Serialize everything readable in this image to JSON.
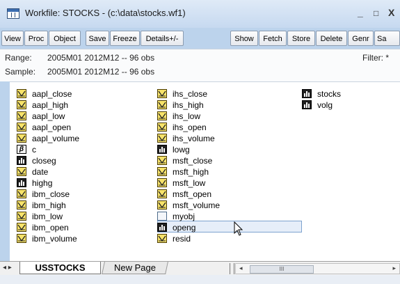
{
  "window": {
    "title": "Workfile: STOCKS - (c:\\data\\stocks.wf1)",
    "minimize_glyph": "_",
    "maximize_glyph": "□",
    "close_glyph": "X"
  },
  "toolbar": {
    "buttons": [
      "View",
      "Proc",
      "Object",
      "Save",
      "Freeze",
      "Details+/-",
      "Show",
      "Fetch",
      "Store",
      "Delete",
      "Genr",
      "Sa"
    ]
  },
  "info": {
    "range_label": "Range:",
    "range_value": "2005M01 2012M12  --  96 obs",
    "sample_label": "Sample:",
    "sample_value": "2005M01 2012M12  --  96 obs",
    "filter": "Filter: *"
  },
  "objects": {
    "col1": [
      {
        "name": "aapl_close",
        "icon": "series-icon"
      },
      {
        "name": "aapl_high",
        "icon": "series-icon"
      },
      {
        "name": "aapl_low",
        "icon": "series-icon"
      },
      {
        "name": "aapl_open",
        "icon": "series-icon"
      },
      {
        "name": "aapl_volume",
        "icon": "series-icon"
      },
      {
        "name": "c",
        "icon": "coefficient-icon"
      },
      {
        "name": "closeg",
        "icon": "group-icon"
      },
      {
        "name": "date",
        "icon": "series-icon"
      },
      {
        "name": "highg",
        "icon": "group-icon"
      },
      {
        "name": "ibm_close",
        "icon": "series-icon"
      },
      {
        "name": "ibm_high",
        "icon": "series-icon"
      },
      {
        "name": "ibm_low",
        "icon": "series-icon"
      },
      {
        "name": "ibm_open",
        "icon": "series-icon"
      },
      {
        "name": "ibm_volume",
        "icon": "series-icon"
      }
    ],
    "col2": [
      {
        "name": "ihs_close",
        "icon": "series-icon"
      },
      {
        "name": "ihs_high",
        "icon": "series-icon"
      },
      {
        "name": "ihs_low",
        "icon": "series-icon"
      },
      {
        "name": "ihs_open",
        "icon": "series-icon"
      },
      {
        "name": "ihs_volume",
        "icon": "series-icon"
      },
      {
        "name": "lowg",
        "icon": "group-icon"
      },
      {
        "name": "msft_close",
        "icon": "series-icon"
      },
      {
        "name": "msft_high",
        "icon": "series-icon"
      },
      {
        "name": "msft_low",
        "icon": "series-icon"
      },
      {
        "name": "msft_open",
        "icon": "series-icon"
      },
      {
        "name": "msft_volume",
        "icon": "series-icon"
      },
      {
        "name": "myobj",
        "icon": "user-object-icon"
      },
      {
        "name": "openg",
        "icon": "group-icon"
      },
      {
        "name": "resid",
        "icon": "series-icon"
      }
    ],
    "col3": [
      {
        "name": "stocks",
        "icon": "group-icon"
      },
      {
        "name": "volg",
        "icon": "group-icon"
      }
    ]
  },
  "tabs": {
    "nav_glyph": "◂ ▸",
    "active": "USSTOCKS",
    "other": "New Page"
  },
  "scrollbar": {
    "left_arrow": "◂",
    "right_arrow": "▸",
    "thumb_grip": "III"
  }
}
